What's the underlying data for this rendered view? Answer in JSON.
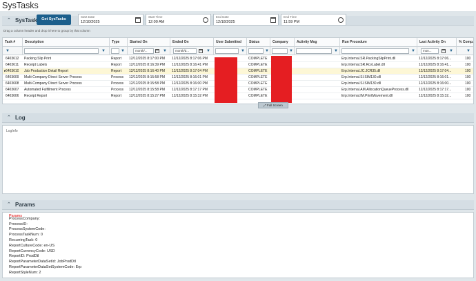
{
  "app": {
    "title": "SysTasks"
  },
  "systask_panel": {
    "title": "SysTask"
  },
  "toolbar": {
    "get_button": "Get SysTasks"
  },
  "dates": {
    "start_date": {
      "label": "Start Date",
      "value": "12/10/2025"
    },
    "start_time": {
      "label": "Start Time",
      "value": "12:00 AM"
    },
    "end_date": {
      "label": "End Date",
      "value": "12/18/2025"
    },
    "end_time": {
      "label": "End Time",
      "value": "11:59 PM"
    }
  },
  "grid": {
    "group_hint": "Drag a column header and drop it here to group by that column",
    "columns": [
      "Task #",
      "Description",
      "Type",
      "Started On",
      "Ended On",
      "User Submitted",
      "Status",
      "Company",
      "Activity Msg",
      "Run Procedure",
      "Last Activity On",
      "% Comp."
    ],
    "filters": {
      "started_on": "month/...",
      "ended_on": "month/d...",
      "last_activity_on": "mon..."
    },
    "rows": [
      [
        "6403612",
        "Packing Slip Print",
        "Report",
        "12/12/2025 8:17:00 PM",
        "12/12/2025 8:17:06 PM",
        "",
        "COMPLETE",
        "",
        "",
        "Erp.Internal.SR.PackingSlipPrint.dll",
        "12/12/2025 8:17:06...",
        "100"
      ],
      [
        "6403611",
        "Receipt Labels",
        "Report",
        "12/12/2025 8:16:39 PM",
        "12/12/2025 8:16:41 PM",
        "",
        "COMPLETE",
        "",
        "",
        "Erp.Internal.SR.RcvLabel.dll",
        "12/12/2025 8:16:41...",
        "100"
      ],
      [
        "6403610",
        "Job Production Detail Report",
        "Report",
        "12/12/2025 8:16:40 PM",
        "12/12/2025 8:17:04 PM",
        "",
        "COMPLETE",
        "",
        "",
        "Erp.Internal.JC.JCR35.dll",
        "12/12/2025 8:17:04...",
        "100"
      ],
      [
        "6403609",
        "Multi-Company Direct Server Process",
        "Process",
        "12/12/2025 8:15:58 PM",
        "12/12/2025 8:16:01 PM",
        "",
        "COMPLETE",
        "",
        "",
        "Erp.Internal.SI.SIM130.dll",
        "12/12/2025 8:16:01...",
        "100"
      ],
      [
        "6403608",
        "Multi-Company Direct Server Process",
        "Process",
        "12/12/2025 8:15:58 PM",
        "12/12/2025 8:16:00 PM",
        "",
        "COMPLETE",
        "",
        "",
        "Erp.Internal.SI.SIM130.dll",
        "12/12/2025 8:16:00...",
        "100"
      ],
      [
        "6403607",
        "Automated Fulfillment Process",
        "Process",
        "12/12/2025 8:15:58 PM",
        "12/12/2025 8:17:17 PM",
        "",
        "COMPLETE",
        "",
        "",
        "Erp.Internal.AM.AllocationQueueProcess.dll",
        "12/12/2025 8:17:17...",
        "100"
      ],
      [
        "6403606",
        "Receipt Report",
        "Report",
        "12/12/2025 8:15:27 PM",
        "12/12/2025 8:15:32 PM",
        "",
        "COMPLETE",
        "",
        "",
        "Erp.Internal.IM.PrintMovement.dll",
        "12/12/2025 8:15:32...",
        "100"
      ]
    ],
    "full_screen": "Full Screen"
  },
  "log_panel": {
    "title": "Log",
    "label": "LogInfo"
  },
  "params_panel": {
    "title": "Params",
    "lines": [
      "Params",
      "ProcessCompany:",
      "ProcessID:",
      "ProcessSystemCode:",
      "ProcessTaskNum: 0",
      "RecurringTask: 0",
      "ReportCultureCode: en-US",
      "ReportCurrencyCode: USD",
      "ReportID: ProdDtl",
      "ReportParameterDataSetId: JobProdDtl",
      "ReportParameterDataSetSystemCode: Erp",
      "ReportStyleNum: 2"
    ]
  }
}
